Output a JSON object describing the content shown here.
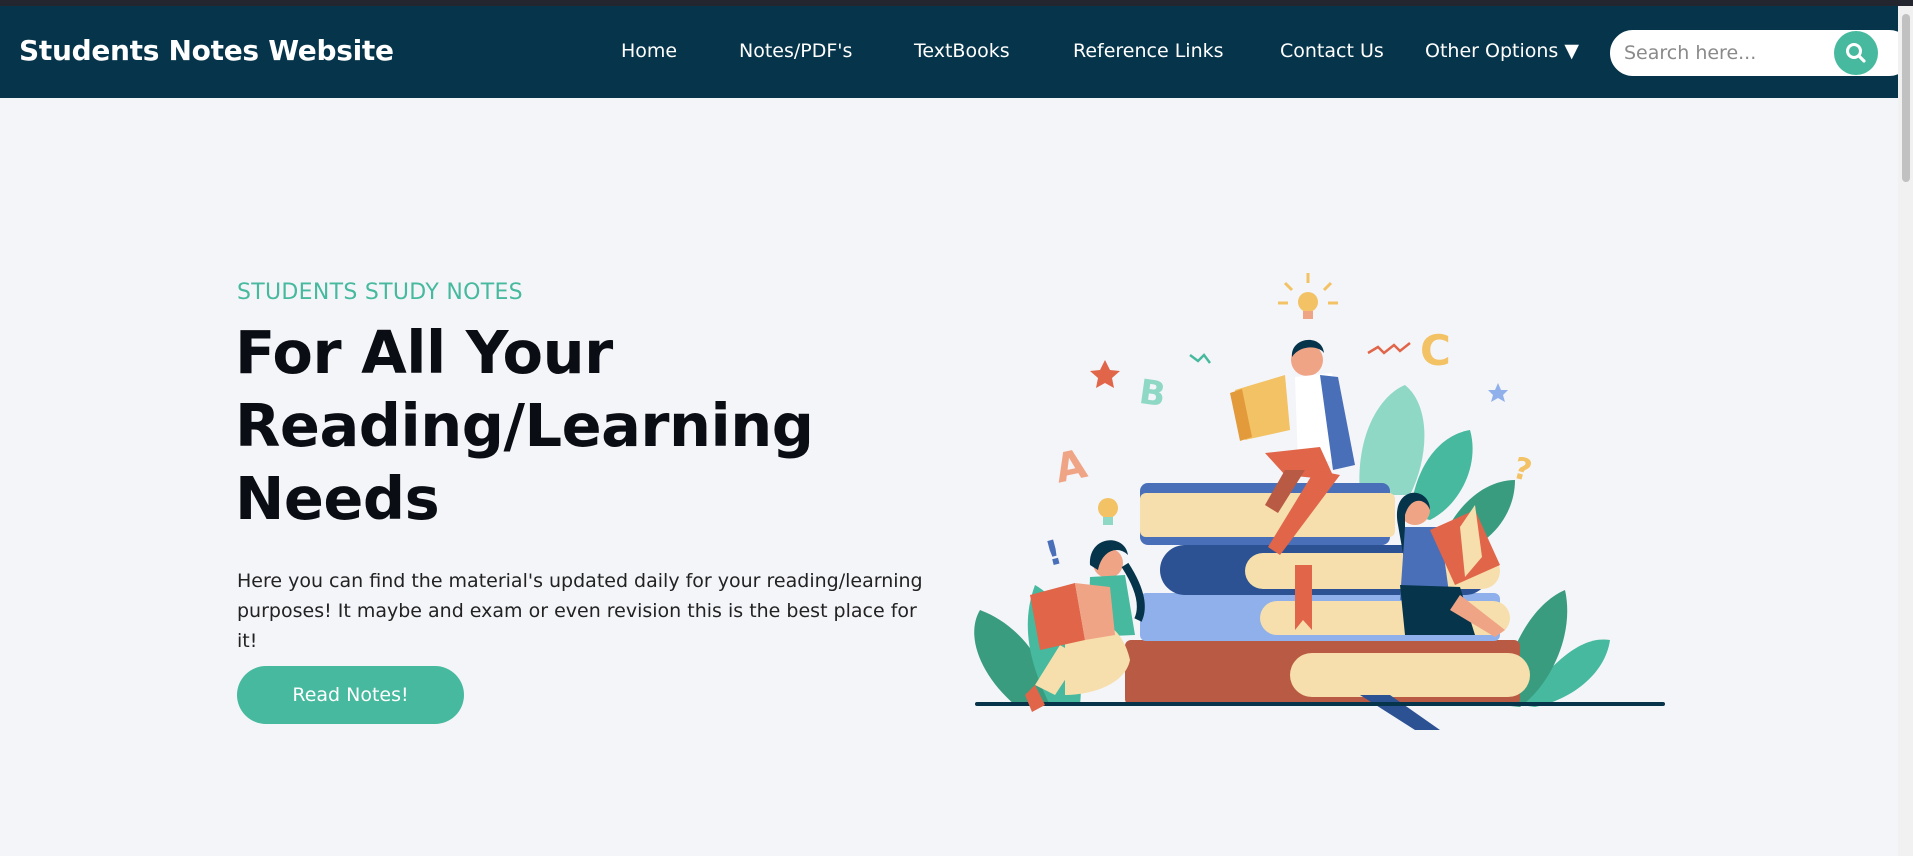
{
  "navbar": {
    "brand": "Students Notes Website",
    "items": [
      {
        "label": "Home"
      },
      {
        "label": "Notes/PDF's"
      },
      {
        "label": "TextBooks"
      },
      {
        "label": "Reference Links"
      },
      {
        "label": "Contact Us"
      },
      {
        "label": "Other Options ▼"
      }
    ],
    "search": {
      "placeholder": "Search here...",
      "icon": "search-icon"
    }
  },
  "hero": {
    "kicker": "STUDENTS STUDY NOTES",
    "headline": "For All Your Reading/Learning Needs",
    "description": "Here you can find the material's updated daily for your reading/learning purposes! It maybe and exam or even revision this is the best place for it!",
    "cta_label": "Read Notes!",
    "illustration": {
      "letters": [
        "A",
        "B",
        "C"
      ],
      "symbols": [
        "!",
        "?"
      ]
    }
  },
  "colors": {
    "navbar": "#06344a",
    "accent": "#46b99e",
    "background": "#f4f5f9"
  }
}
